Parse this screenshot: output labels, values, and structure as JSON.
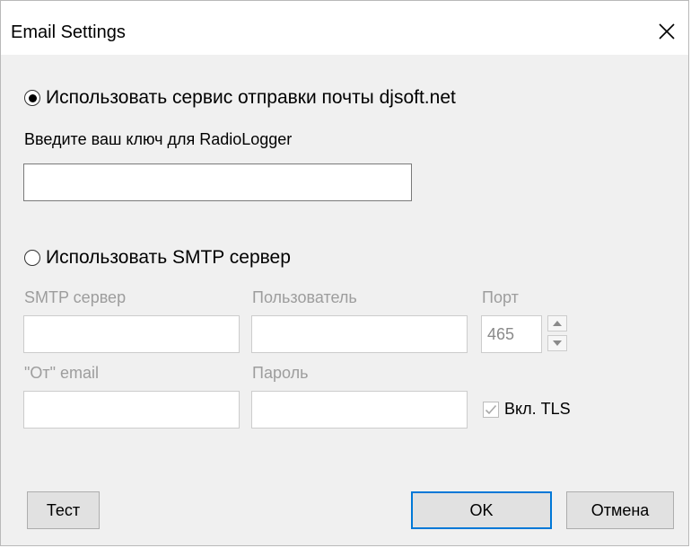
{
  "window": {
    "title": "Email Settings",
    "close_glyph": "✕"
  },
  "service": {
    "radio_label": "Использовать сервис отправки почты djsoft.net",
    "selected": true,
    "key_label": "Введите ваш ключ для RadioLogger",
    "key_value": ""
  },
  "smtp": {
    "radio_label": "Использовать SMTP сервер",
    "selected": false,
    "server_label": "SMTP сервер",
    "server_value": "",
    "user_label": "Пользователь",
    "user_value": "",
    "port_label": "Порт",
    "port_value": "465",
    "from_label": "\"От\" email",
    "from_value": "",
    "password_label": "Пароль",
    "password_value": "",
    "tls_label": "Вкл. TLS",
    "tls_checked": true
  },
  "buttons": {
    "test_label": "Тест",
    "ok_label": "OK",
    "cancel_label": "Отмена"
  },
  "icons": {
    "close": "close-icon",
    "spin_up": "chevron-up-icon",
    "spin_down": "chevron-down-icon",
    "check": "checkmark-icon"
  },
  "colors": {
    "default_button_border": "#0078d7",
    "disabled_text": "#9d9d9d"
  }
}
